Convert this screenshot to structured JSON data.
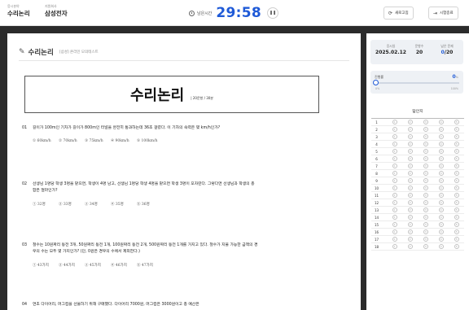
{
  "header": {
    "field_label": "응시분야",
    "field_value": "수리논리",
    "company_label": "지원회사",
    "company_value": "삼성전자",
    "timer_label": "남은시간",
    "timer_value": "29:58",
    "pause_icon": "pause-icon",
    "refresh_label": "새로고침",
    "exit_label": "시험종료"
  },
  "paper": {
    "subject": "수리논리",
    "subtitle": "[삼성] 온라인 모의테스트",
    "title": "수리논리",
    "title_meta": "| 20문항 / 30분",
    "questions": [
      {
        "num": "01",
        "text": "길이가 100m인 기차가 길이가 800m인 터널을 완전히 통과하는데 36초 걸렸다. 이 기차의 속력은 몇 km/h인가?",
        "options": [
          "① 60km/h",
          "② 70km/h",
          "③ 75km/h",
          "④ 90km/h",
          "⑤ 100km/h"
        ]
      },
      {
        "num": "02",
        "text": "선생님 1명당 학생 3명을 맡으면, 학생이 4명 남고, 선생님 1명당 학생 4명을 맡으면 학생 3명이 모자란다. 그렇다면 선생님과 학생의 총 합은 얼마인가?",
        "options": [
          "① 32명",
          "② 33명",
          "③ 34명",
          "④ 35명",
          "⑤ 36명"
        ]
      },
      {
        "num": "03",
        "text": "철수는 10원짜리 동전 3개, 50원짜리 동전 1개, 100원짜리 동전 2개, 500원짜리 동전 1개를 가지고 있다. 철수가 지불 가능한 금액의 경우의 수는 모두 몇 가지인가? (단, 0원은 경우의 수에서 제외한다.)",
        "options": [
          "① 43가지",
          "② 44가지",
          "③ 45가지",
          "④ 46가지",
          "⑤ 47가지"
        ]
      },
      {
        "num": "04",
        "text": "연초 다이어리, 머그컵을 선물하기 위해 구매했다. 다이어리 7000원, 머그컵은 3000원이고 총 예산은",
        "options": []
      }
    ]
  },
  "sidebar": {
    "exam_date_label": "응시일",
    "exam_date": "2025.02.12",
    "total_label": "문항수",
    "total_value": "20",
    "remaining_label": "남은 문제",
    "remaining_done": "0",
    "remaining_total": "/20",
    "rate_label": "진행률",
    "rate_value": "0",
    "rate_unit": "%",
    "rate_min": "0%",
    "rate_max": "100%",
    "rate_fraction": 0,
    "answer_sheet_title": "답안지",
    "answer_rows": [
      "1",
      "2",
      "3",
      "4",
      "5",
      "6",
      "7",
      "8",
      "9",
      "10",
      "11",
      "12",
      "13",
      "14",
      "15",
      "16",
      "17",
      "18"
    ],
    "choice_marks": [
      "1",
      "2",
      "3",
      "4",
      "5"
    ]
  }
}
